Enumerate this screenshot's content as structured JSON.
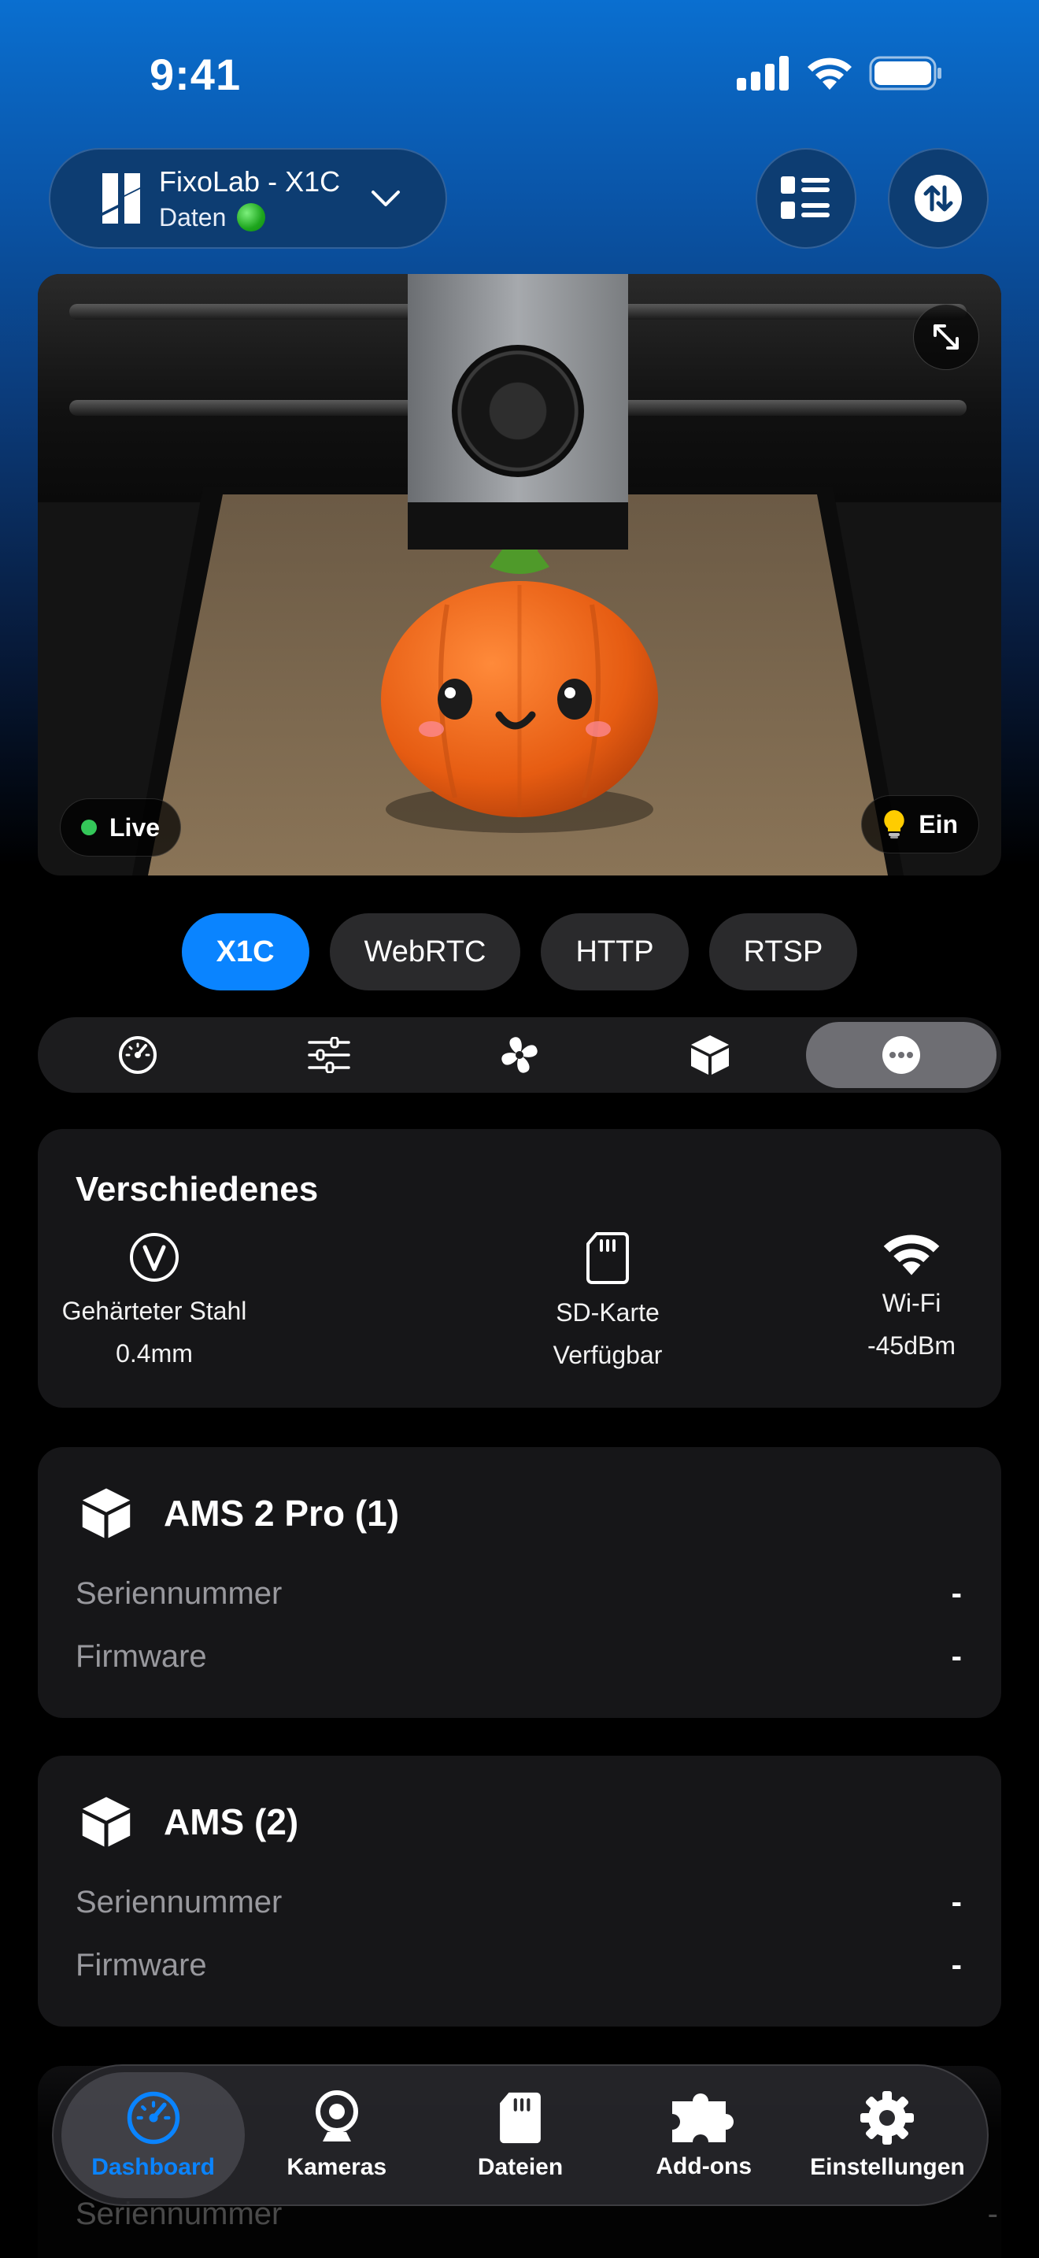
{
  "status_bar": {
    "time": "9:41"
  },
  "header": {
    "printer_name": "FixoLab - X1C",
    "printer_subtitle": "Daten",
    "connection_status_color": "#1da51d"
  },
  "camera": {
    "live_label": "Live",
    "light_label": "Ein"
  },
  "stream_tabs": [
    "X1C",
    "WebRTC",
    "HTTP",
    "RTSP"
  ],
  "sections": {
    "icons": [
      "speedometer-icon",
      "sliders-icon",
      "fan-icon",
      "cube-icon",
      "more-icon"
    ],
    "active_index": 4
  },
  "misc": {
    "title": "Verschiedenes",
    "plate_line1": "Gehärteter Stahl",
    "plate_line2": "0.4mm",
    "sd_line1": "SD-Karte",
    "sd_line2": "Verfügbar",
    "wifi_line1": "Wi-Fi",
    "wifi_line2": "-45dBm"
  },
  "ams_cards": [
    {
      "title": "AMS 2 Pro (1)",
      "serial_label": "Seriennummer",
      "serial_value": "-",
      "firmware_label": "Firmware",
      "firmware_value": "-"
    },
    {
      "title": "AMS (2)",
      "serial_label": "Seriennummer",
      "serial_value": "-",
      "firmware_label": "Firmware",
      "firmware_value": "-"
    }
  ],
  "ghost": {
    "serial_label": "Seriennummer",
    "dash": "-"
  },
  "tabbar": {
    "tabs": [
      "Dashboard",
      "Kameras",
      "Dateien",
      "Add-ons",
      "Einstellungen"
    ],
    "active_index": 0
  },
  "colors": {
    "accent": "#0a84ff",
    "card": "#161618",
    "live": "#34c759"
  }
}
